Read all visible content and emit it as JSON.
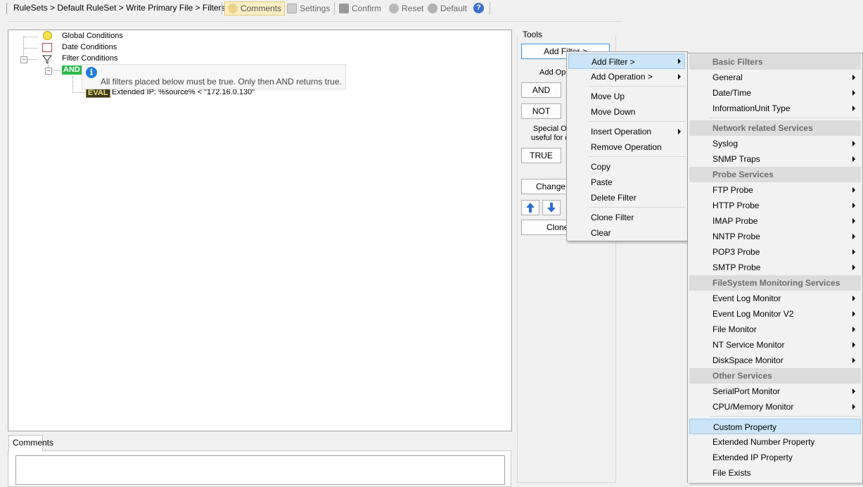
{
  "toolbar": {
    "breadcrumb": "RuleSets > Default RuleSet > Write Primary File > Filters",
    "comments": "Comments",
    "settings": "Settings",
    "confirm": "Confirm",
    "reset": "Reset",
    "default": "Default"
  },
  "tree": {
    "global": "Global Conditions",
    "date": "Date Conditions",
    "filter": "Filter Conditions",
    "and_badge": "AND",
    "eval_badge": "EVAL",
    "eval_text": "Extended IP: %source% < \"172.16.0.130\"",
    "tooltip": "All filters placed below must be true. Only then AND returns true."
  },
  "tools": {
    "title": "Tools",
    "add_filter": "Add Filter >",
    "add_operation_label": "Add Ope",
    "and": "AND",
    "not": "NOT",
    "special_1": "Special O",
    "special_2": "useful for c",
    "true": "TRUE",
    "change": "Change C",
    "clone": "Clone"
  },
  "comments": {
    "tab": "Comments"
  },
  "context_menu": {
    "items": [
      {
        "label": "Add Filter >",
        "submenu": true
      },
      {
        "label": "Add Operation >",
        "submenu": true
      },
      {
        "label": "Move Up"
      },
      {
        "label": "Move Down"
      },
      {
        "label": "Insert Operation",
        "submenu": true
      },
      {
        "label": "Remove Operation"
      },
      {
        "label": "Copy"
      },
      {
        "label": "Paste"
      },
      {
        "label": "Delete Filter"
      },
      {
        "label": "Clone Filter"
      },
      {
        "label": "Clear"
      }
    ]
  },
  "filter_submenu": {
    "basic_header": "Basic Filters",
    "general": "General",
    "datetime": "Date/Time",
    "infounit": "InformationUnit Type",
    "network_header": "Network related Services",
    "syslog": "Syslog",
    "snmp": "SNMP Traps",
    "probe_header": "Probe Services",
    "ftp": "FTP Probe",
    "http": "HTTP Probe",
    "imap": "IMAP Probe",
    "nntp": "NNTP Probe",
    "pop3": "POP3 Probe",
    "smtp": "SMTP Probe",
    "fs_header": "FileSystem Monitoring Services",
    "eventlog": "Event Log Monitor",
    "eventlog2": "Event Log Monitor V2",
    "filemon": "File Monitor",
    "ntservice": "NT Service Monitor",
    "diskspace": "DiskSpace Monitor",
    "other_header": "Other Services",
    "serialport": "SerialPort Monitor",
    "cpumem": "CPU/Memory Monitor",
    "custom": "Custom Property",
    "extnum": "Extended Number Property",
    "extip": "Extended IP Property",
    "fileexists": "File Exists"
  },
  "colors": {
    "highlight": "#cce4f7",
    "and_badge": "#2db84a",
    "info": "#1f7fd8"
  }
}
